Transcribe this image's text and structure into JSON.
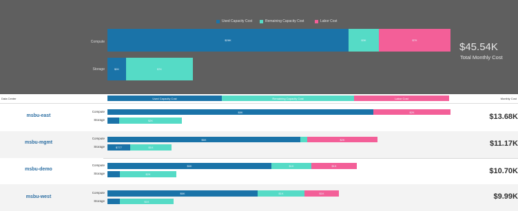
{
  "colors": {
    "used": "#1a73a8",
    "remaining": "#55dbc6",
    "labor": "#f35f98",
    "panel": "#5f5f5f"
  },
  "summary": {
    "legend": [
      {
        "label": "Used Capacity Cost",
        "color": "#1a73a8"
      },
      {
        "label": "Remaining Capacity Cost",
        "color": "#55dbc6"
      },
      {
        "label": "Labor Cost",
        "color": "#f35f98"
      }
    ],
    "compute": {
      "label": "Compute",
      "used": "$26K",
      "remaining": "$3K",
      "labor": "$7K"
    },
    "storage": {
      "label": "Storage",
      "used": "$2K",
      "remaining": "$7K"
    },
    "total_amount": "$45.54K",
    "total_label": "Total Monthly Cost"
  },
  "table": {
    "headers": {
      "data_center": "Data Center",
      "used": "Used Capacity Cost",
      "remaining": "Remaining Capacity Cost",
      "labor": "Labor Cost",
      "monthly_cost": "Monthly Cost"
    },
    "rows": [
      {
        "name": "msbu-east",
        "cost": "$13.68K",
        "compute": {
          "label": "Compute",
          "used": "$8K",
          "remaining": "",
          "labor": "$2K"
        },
        "storage": {
          "label": "Storage",
          "used": "",
          "remaining": "$2K"
        }
      },
      {
        "name": "msbu-mgmt",
        "cost": "$11.17K",
        "compute": {
          "label": "Compute",
          "used": "$6K",
          "remaining": "",
          "labor": "$2K"
        },
        "storage": {
          "label": "Storage",
          "used": "$777",
          "remaining": "$1K"
        }
      },
      {
        "name": "msbu-demo",
        "cost": "$10.70K",
        "compute": {
          "label": "Compute",
          "used": "$6K",
          "remaining": "$1K",
          "labor": "$1K"
        },
        "storage": {
          "label": "Storage",
          "used": "",
          "remaining": "$2K"
        }
      },
      {
        "name": "msbu-west",
        "cost": "$9.99K",
        "compute": {
          "label": "Compute",
          "used": "$6K",
          "remaining": "$1K",
          "labor": "$1K"
        },
        "storage": {
          "label": "Storage",
          "used": "",
          "remaining": "$1K"
        }
      }
    ]
  }
}
